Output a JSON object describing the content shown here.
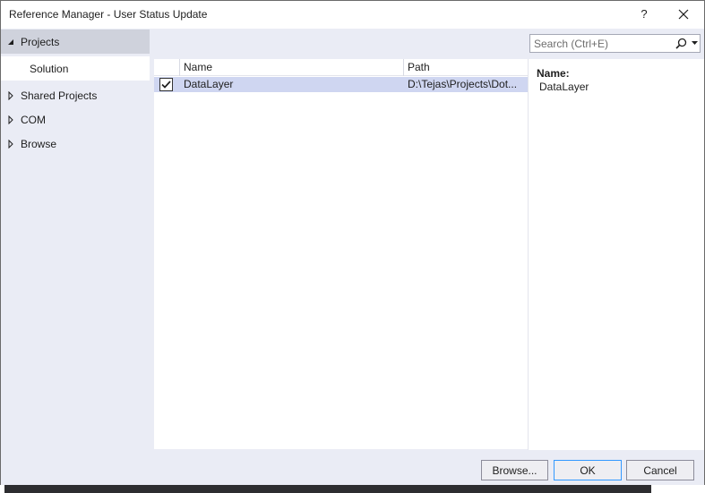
{
  "window": {
    "title": "Reference Manager - User Status Update",
    "help_glyph": "?"
  },
  "nav": {
    "items": [
      {
        "label": "Projects",
        "expanded": true
      },
      {
        "label": "Solution",
        "selected": true
      },
      {
        "label": "Shared Projects",
        "expanded": false
      },
      {
        "label": "COM",
        "expanded": false
      },
      {
        "label": "Browse",
        "expanded": false
      }
    ]
  },
  "search": {
    "placeholder": "Search (Ctrl+E)",
    "icon": "search-icon"
  },
  "grid": {
    "columns": [
      "Name",
      "Path"
    ],
    "rows": [
      {
        "checked": true,
        "name": "DataLayer",
        "path": "D:\\Tejas\\Projects\\Dot..."
      }
    ]
  },
  "details": {
    "name_label": "Name:",
    "name_value": "DataLayer"
  },
  "footer": {
    "browse_label": "Browse...",
    "ok_label": "OK",
    "cancel_label": "Cancel"
  },
  "colors": {
    "panel_bg": "#eaecf5",
    "selected_row": "#cfd6f1",
    "default_button_border": "#3399ff"
  }
}
